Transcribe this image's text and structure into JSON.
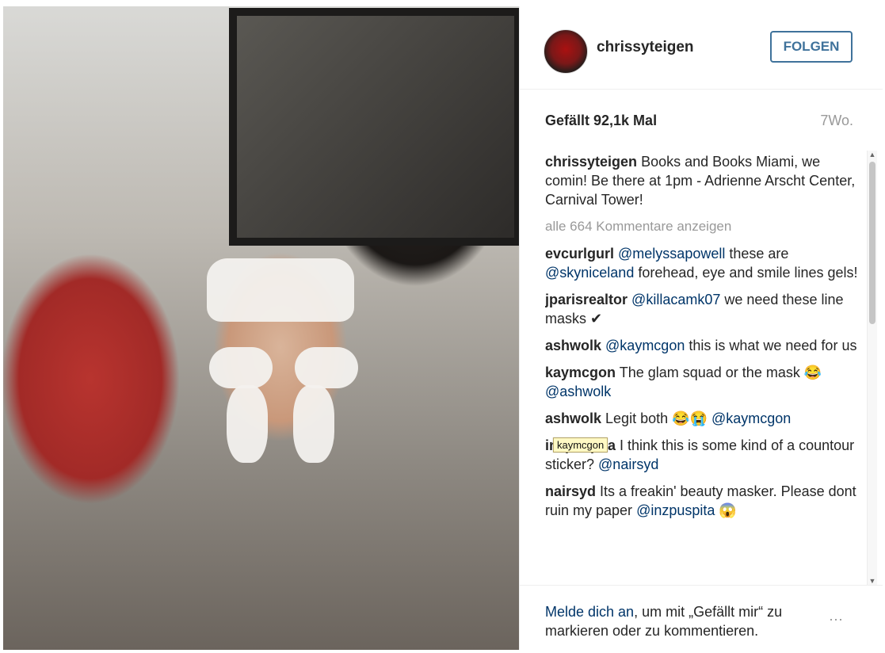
{
  "profile": {
    "username": "chrissyteigen",
    "follow_label": "FOLGEN"
  },
  "post": {
    "likes": "Gefällt 92,1k Mal",
    "time": "7Wo.",
    "caption": "Books and Books Miami, we comin! Be there at 1pm - Adrienne Arscht Center, Carnival Tower!",
    "view_all": "alle 664 Kommentare anzeigen"
  },
  "comments": [
    {
      "user": "evcurlgurl",
      "parts": [
        {
          "kind": "mention",
          "text": "@melyssapowell"
        },
        {
          "kind": "text",
          "text": " these are "
        },
        {
          "kind": "mention",
          "text": "@skyniceland"
        },
        {
          "kind": "text",
          "text": " forehead, eye and smile lines gels!"
        }
      ]
    },
    {
      "user": "jparisrealtor",
      "parts": [
        {
          "kind": "mention",
          "text": "@killacamk07"
        },
        {
          "kind": "text",
          "text": " we need these line masks "
        },
        {
          "kind": "text",
          "text": "✔"
        }
      ]
    },
    {
      "user": "ashwolk",
      "parts": [
        {
          "kind": "mention",
          "text": "@kaymcgon"
        },
        {
          "kind": "text",
          "text": " this is what we need for us"
        }
      ]
    },
    {
      "user": "kaymcgon",
      "parts": [
        {
          "kind": "text",
          "text": " The glam squad or the mask "
        },
        {
          "kind": "text",
          "text": "😂 "
        },
        {
          "kind": "mention",
          "text": "@ashwolk"
        }
      ]
    },
    {
      "user": "ashwolk",
      "parts": [
        {
          "kind": "text",
          "text": " Legit both "
        },
        {
          "kind": "text",
          "text": "😂😭 "
        },
        {
          "kind": "mention",
          "text": "@kaymcgon"
        }
      ]
    },
    {
      "user": "inzpuspita",
      "parts": [
        {
          "kind": "text",
          "text": " I think this is some kind of a countour sticker? "
        },
        {
          "kind": "mention",
          "text": "@nairsyd"
        }
      ]
    },
    {
      "user": "nairsyd",
      "parts": [
        {
          "kind": "text",
          "text": " Its a freakin' beauty masker. Please dont ruin my paper "
        },
        {
          "kind": "mention",
          "text": "@inzpuspita"
        },
        {
          "kind": "text",
          "text": " 😱"
        }
      ]
    }
  ],
  "tooltip": "kaymcgon",
  "footer": {
    "login_link": "Melde dich an",
    "rest": ", um mit „Gefällt mir“ zu markieren oder zu kommentieren.",
    "more": "⋯"
  },
  "icons": {
    "checkmark": "check-icon",
    "emoji_laugh": "laughing-emoji-icon",
    "emoji_cry": "crying-emoji-icon",
    "emoji_scream": "screaming-emoji-icon"
  },
  "colors": {
    "link": "#003569",
    "follow_border": "#3f729b",
    "muted": "#999999"
  }
}
